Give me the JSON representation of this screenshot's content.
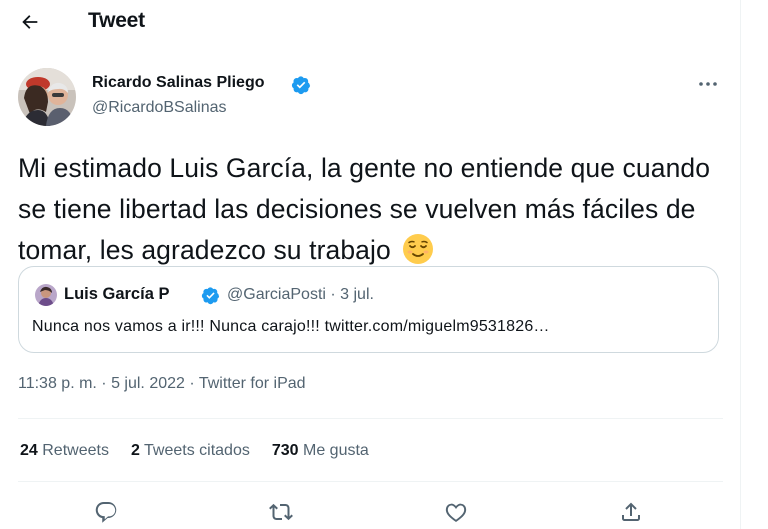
{
  "header": {
    "title": "Tweet",
    "back_icon": "back-arrow-icon"
  },
  "tweet": {
    "author": {
      "name": "Ricardo Salinas Pliego",
      "handle": "@RicardoBSalinas",
      "verified": true
    },
    "text": "Mi estimado Luis García, la gente no entiende que cuando se tiene libertad las decisiones se vuelven más fáciles de tomar, les agradezco su trabajo",
    "emoji": "relieved-face-emoji",
    "quote": {
      "name": "Luis García P",
      "handle": "@GarciaPosti · 3 jul.",
      "verified": true,
      "text": "Nunca nos vamos a ir!!! Nunca carajo!!! twitter.com/miguelm9531826…"
    },
    "meta": {
      "time": "11:38 p. m.",
      "separator": " · ",
      "date": "5 jul. 2022",
      "source": "Twitter for iPad"
    },
    "stats": [
      {
        "count": "24",
        "label": "Retweets"
      },
      {
        "count": "2",
        "label": "Tweets citados"
      },
      {
        "count": "730",
        "label": "Me gusta"
      }
    ]
  },
  "actions": [
    "reply-icon",
    "retweet-icon",
    "like-icon",
    "share-icon"
  ],
  "colors": {
    "text": "#0f1419",
    "secondary": "#536471",
    "border": "#cfd9de",
    "divider": "#eff3f4",
    "verified": "#1d9bf0"
  }
}
